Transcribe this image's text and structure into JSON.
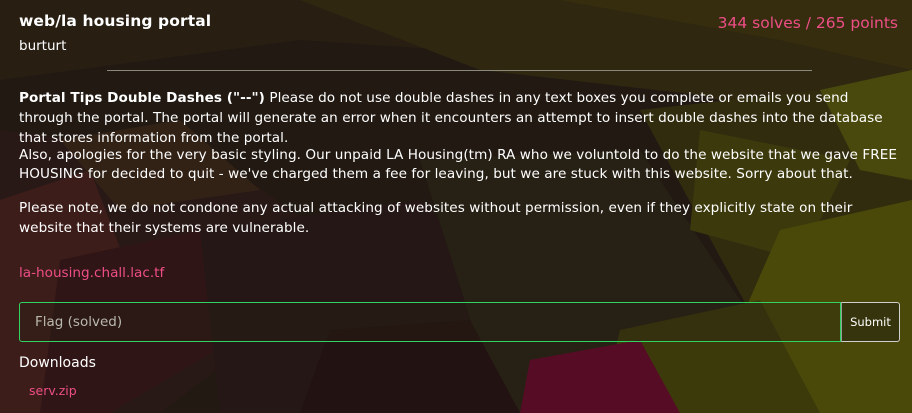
{
  "challenge": {
    "title": "web/la housing portal",
    "author": "burturt",
    "stats": "344 solves / 265 points"
  },
  "description": {
    "tip_heading": "Portal Tips Double Dashes (\"--\")",
    "tip_text": " Please do not use double dashes in any text boxes you complete or emails you send through the portal. The portal will generate an error when it encounters an attempt to insert double dashes into the database that stores information from the portal.",
    "apology": "Also, apologies for the very basic styling. Our unpaid LA Housing(tm) RA who we voluntold to do the website that we gave FREE HOUSING for decided to quit - we've charged them a fee for leaving, but we are stuck with this website. Sorry about that.",
    "note": "Please note, we do not condone any actual attacking of websites without permission, even if they explicitly state on their website that their systems are vulnerable."
  },
  "challenge_link": "la-housing.chall.lac.tf",
  "flag_form": {
    "placeholder": "Flag (solved)",
    "submit_label": "Submit"
  },
  "downloads": {
    "title": "Downloads",
    "files": [
      "serv.zip"
    ]
  },
  "colors": {
    "accent_pink": "#ee4e86",
    "input_border_green": "#31d460"
  }
}
